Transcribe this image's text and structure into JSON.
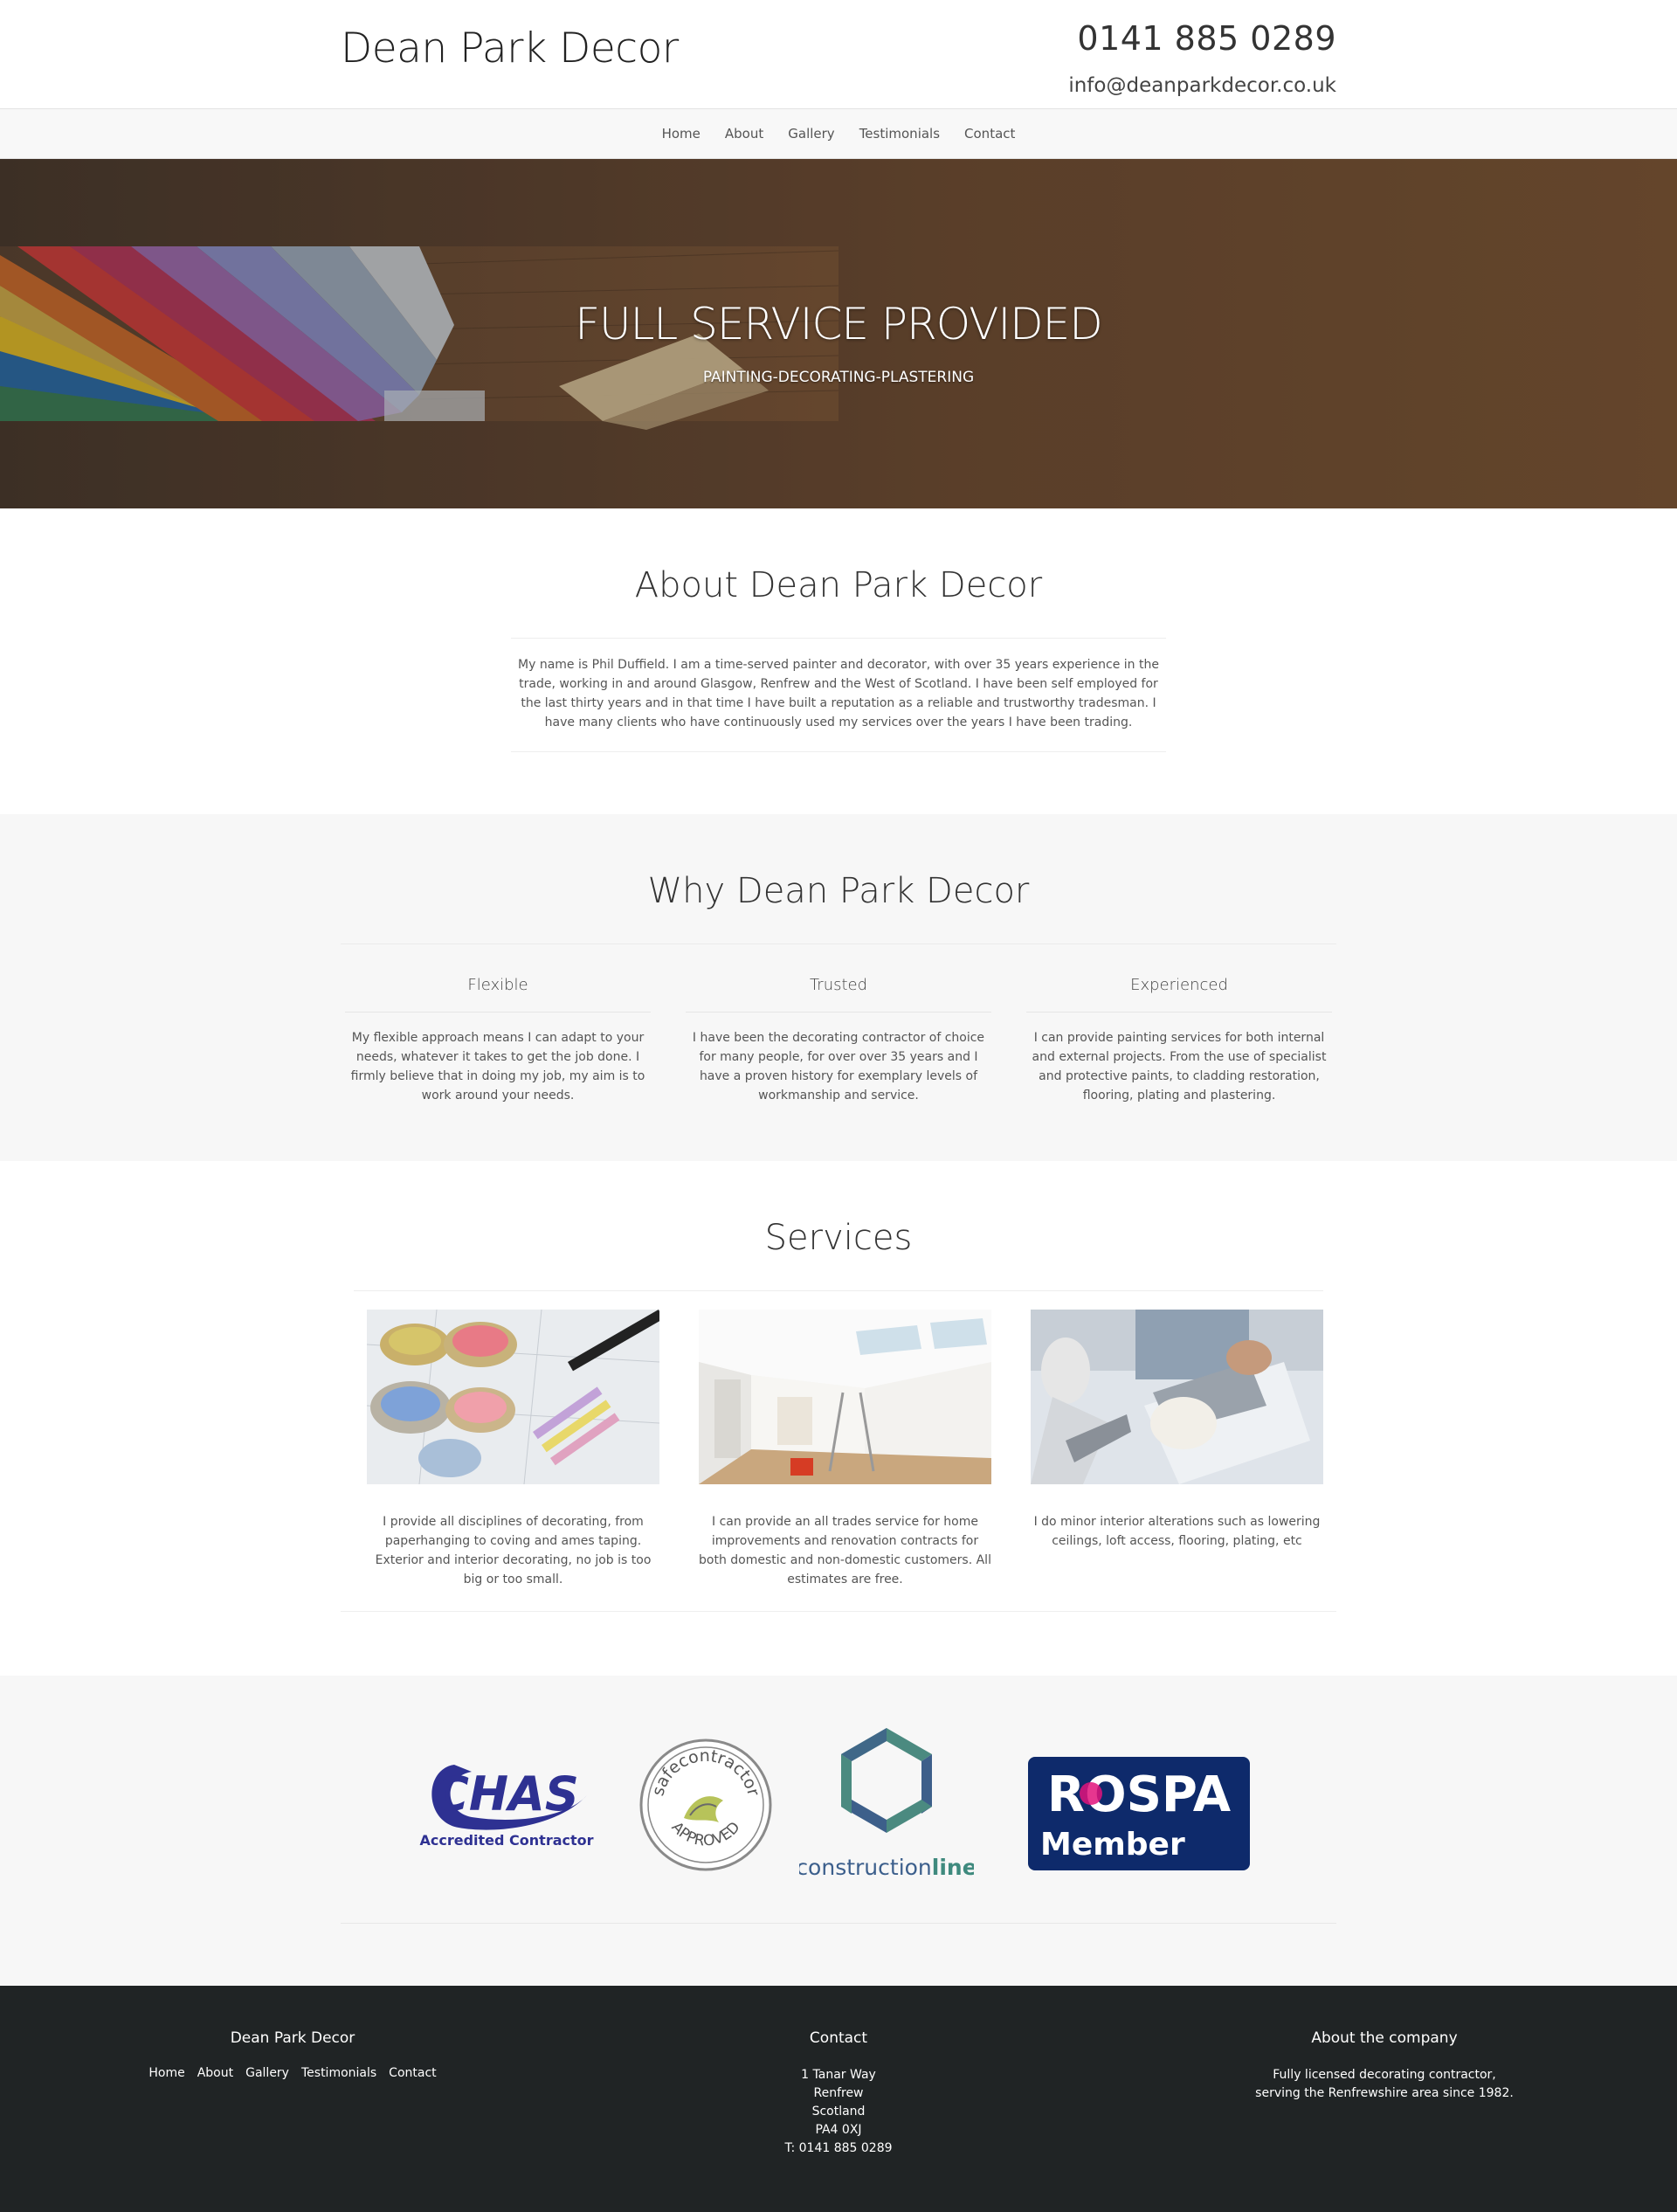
{
  "header": {
    "brand": "Dean Park Decor",
    "phone": "0141 885 0289",
    "email": "info@deanparkdecor.co.uk"
  },
  "nav": {
    "items": [
      "Home",
      "About",
      "Gallery",
      "Testimonials",
      "Contact"
    ]
  },
  "hero": {
    "title": "FULL SERVICE PROVIDED",
    "subtitle": "PAINTING-DECORATING-PLASTERING"
  },
  "about": {
    "title": "About Dean Park Decor",
    "text": "My name is Phil Duffield. I am a time-served painter and decorator, with over 35 years experience in the trade, working in and around Glasgow, Renfrew and the West of Scotland. I have been self employed for the last thirty years and in that time I have built a reputation as a reliable and trustworthy tradesman. I have many clients who have continuously used my services over the years I have been trading."
  },
  "why": {
    "title": "Why Dean Park Decor",
    "columns": [
      {
        "heading": "Flexible",
        "text": "My flexible approach means I can adapt to your needs, whatever it takes to get the job done. I firmly believe that in doing my job, my aim is to work around your needs."
      },
      {
        "heading": "Trusted",
        "text": "I have been the decorating contractor of choice for many people, for over over 35 years and I have a proven history for exemplary levels of workmanship and service."
      },
      {
        "heading": "Experienced",
        "text": "I can provide painting services for both internal and external projects. From the use of specialist and protective paints, to cladding restoration, flooring, plating and plastering."
      }
    ]
  },
  "services": {
    "title": "Services",
    "items": [
      {
        "image": "paint-tins-image",
        "text": "I provide all disciplines of decorating, from paperhanging to coving and ames taping. Exterior and interior decorating, no job is too big or too small."
      },
      {
        "image": "room-renovation-image",
        "text": "I can provide an all trades service for home improvements and renovation contracts for both domestic and non-domestic customers. All estimates are free."
      },
      {
        "image": "plastering-image",
        "text": "I do minor interior alterations such as lowering ceilings, loft access, flooring, plating, etc"
      }
    ]
  },
  "accreditations": {
    "chas": {
      "mark": "CHAS",
      "caption": "Accredited Contractor",
      "color": "#2e3192"
    },
    "safecontractor": {
      "top": "safecontractor",
      "bottom": "APPROVED",
      "color": "#555555"
    },
    "constructionline": {
      "word1": "construction",
      "word2": "line",
      "color1": "#3c5f8c",
      "color2": "#3f8a7e"
    },
    "rospa": {
      "mark": "ROSPA",
      "caption": "Member",
      "color": "#0e2a6b"
    }
  },
  "footer": {
    "col1": {
      "title": "Dean Park Decor",
      "links": [
        "Home",
        "About",
        "Gallery",
        "Testimonials",
        "Contact"
      ]
    },
    "col2": {
      "title": "Contact",
      "lines": [
        "1 Tanar Way",
        "Renfrew",
        "Scotland",
        "PA4 0XJ",
        "T: 0141 885 0289"
      ]
    },
    "col3": {
      "title": "About the company",
      "lines": [
        "Fully licensed decorating contractor,",
        "serving the Renfrewshire area since 1982."
      ]
    }
  }
}
